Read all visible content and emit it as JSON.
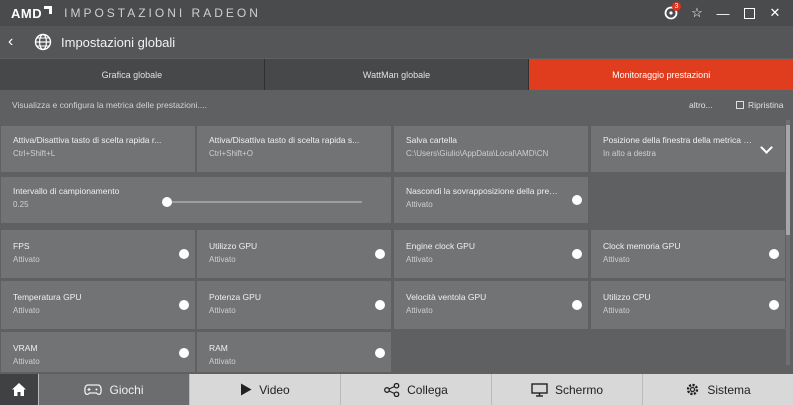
{
  "titlebar": {
    "brand": "AMD",
    "title": "IMPOSTAZIONI RADEON",
    "notification_count": "3"
  },
  "header": {
    "title": "Impostazioni globali"
  },
  "tabs": [
    {
      "label": "Grafica globale",
      "active": false
    },
    {
      "label": "WattMan globale",
      "active": false
    },
    {
      "label": "Monitoraggio prestazioni",
      "active": true
    }
  ],
  "toolbar": {
    "hint": "Visualizza e configura la metrica delle prestazioni....",
    "more_label": "altro...",
    "reset_label": "Ripristina"
  },
  "settings": {
    "hotkey_toggle": {
      "title": "Attiva/Disattiva tasto di scelta rapida r...",
      "value": "Ctrl+Shift+L"
    },
    "hotkey_save": {
      "title": "Attiva/Disattiva tasto di scelta rapida s...",
      "value": "Ctrl+Shift+O"
    },
    "save_folder": {
      "title": "Salva cartella",
      "value": "C:\\Users\\Giulio\\AppData\\Local\\AMD\\CN"
    },
    "window_position": {
      "title": "Posizione della finestra della metrica d...",
      "value": "In alto a destra"
    },
    "sampling_interval": {
      "title": "Intervallo di campionamento",
      "value": "0.25",
      "slider_fraction": 0.0
    },
    "hide_overlay": {
      "title": "Nascondi la sovrapposizione della prest...",
      "value": "Attivato"
    }
  },
  "metrics": [
    {
      "title": "FPS",
      "status": "Attivato"
    },
    {
      "title": "Utilizzo GPU",
      "status": "Attivato"
    },
    {
      "title": "Engine clock GPU",
      "status": "Attivato"
    },
    {
      "title": "Clock memoria GPU",
      "status": "Attivato"
    },
    {
      "title": "Temperatura GPU",
      "status": "Attivato"
    },
    {
      "title": "Potenza GPU",
      "status": "Attivato"
    },
    {
      "title": "Velocità ventola GPU",
      "status": "Attivato"
    },
    {
      "title": "Utilizzo CPU",
      "status": "Attivato"
    },
    {
      "title": "VRAM",
      "status": "Attivato"
    },
    {
      "title": "RAM",
      "status": "Attivato"
    }
  ],
  "bottom_nav": [
    {
      "label": "Giochi",
      "icon": "gamepad-icon",
      "active": true
    },
    {
      "label": "Video",
      "icon": "play-icon",
      "active": false
    },
    {
      "label": "Collega",
      "icon": "share-icon",
      "active": false
    },
    {
      "label": "Schermo",
      "icon": "monitor-icon",
      "active": false
    },
    {
      "label": "Sistema",
      "icon": "gear-icon",
      "active": false
    }
  ],
  "colors": {
    "accent": "#e03d1f",
    "background": "#5f6061",
    "card": "#727375"
  }
}
